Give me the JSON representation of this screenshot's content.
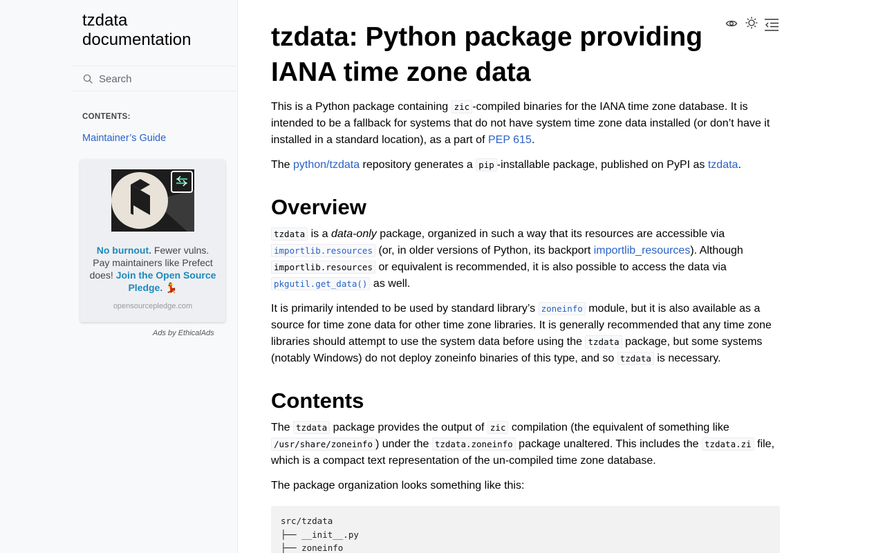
{
  "sidebar": {
    "brand_line1": "tzdata",
    "brand_line2": "documentation",
    "search_placeholder": "Search",
    "toc_caption": "CONTENTS:",
    "toc_items": [
      {
        "label": "Maintainer’s Guide"
      }
    ]
  },
  "ad": {
    "headline_bold": "No burnout.",
    "text_1": "Fewer vulns. Pay maintainers like Prefect does!",
    "cta_bold": "Join the Open Source Pledge.",
    "emoji": "💃",
    "domain": "opensourcepledge.com",
    "ads_by": "Ads by EthicalAds",
    "accent_color": "#1c89bd"
  },
  "header_icons": [
    "view-source-icon",
    "theme-toggle-icon",
    "toc-toggle-icon"
  ],
  "page": {
    "title": "tzdata: Python package providing IANA time zone data",
    "intro": {
      "p1_a": "This is a Python package containing ",
      "p1_code": "zic",
      "p1_b": "-compiled binaries for the IANA time zone database. It is intended to be a fallback for systems that do not have system time zone data installed (or don’t have it installed in a standard location), as a part of ",
      "p1_link": "PEP 615",
      "p1_c": ".",
      "p2_a": "The ",
      "p2_link1": "python/tzdata",
      "p2_b": " repository generates a ",
      "p2_code": "pip",
      "p2_c": "-installable package, published on PyPI as ",
      "p2_link2": "tzdata",
      "p2_d": "."
    },
    "overview": {
      "heading": "Overview",
      "p1_code1": "tzdata",
      "p1_a": " is a ",
      "p1_em": "data-only",
      "p1_b": " package, organized in such a way that its resources are accessible via ",
      "p1_code2": "importlib.resources",
      "p1_c": " (or, in older versions of Python, its backport ",
      "p1_link": "importlib_resources",
      "p1_d": "). Although ",
      "p1_code3": "importlib.resources",
      "p1_e": " or equivalent is recommended, it is also possible to access the data via ",
      "p1_code4": "pkgutil.get_data()",
      "p1_f": " as well.",
      "p2_a": "It is primarily intended to be used by standard library’s ",
      "p2_code1": "zoneinfo",
      "p2_b": " module, but it is also available as a source for time zone data for other time zone libraries. It is generally recommended that any time zone libraries should attempt to use the system data before using the ",
      "p2_code2": "tzdata",
      "p2_c": " package, but some systems (notably Windows) do not deploy zoneinfo binaries of this type, and so ",
      "p2_code3": "tzdata",
      "p2_d": " is necessary."
    },
    "contents": {
      "heading": "Contents",
      "p1_a": "The ",
      "p1_code1": "tzdata",
      "p1_b": " package provides the output of ",
      "p1_code2": "zic",
      "p1_c": " compilation (the equivalent of something like ",
      "p1_code3": "/usr/share/zoneinfo",
      "p1_d": ") under the ",
      "p1_code4": "tzdata.zoneinfo",
      "p1_e": " package unaltered. This includes the ",
      "p1_code5": "tzdata.zi",
      "p1_f": " file, which is a compact text representation of the un-compiled time zone database.",
      "p2": "The package organization looks something like this:",
      "pre": "src/tzdata\n├── __init__.py\n├── zoneinfo"
    }
  },
  "colors": {
    "link": "#2962c7",
    "sidebar_bg": "#f8f9fb",
    "code_block_bg": "#f2f2f2"
  }
}
